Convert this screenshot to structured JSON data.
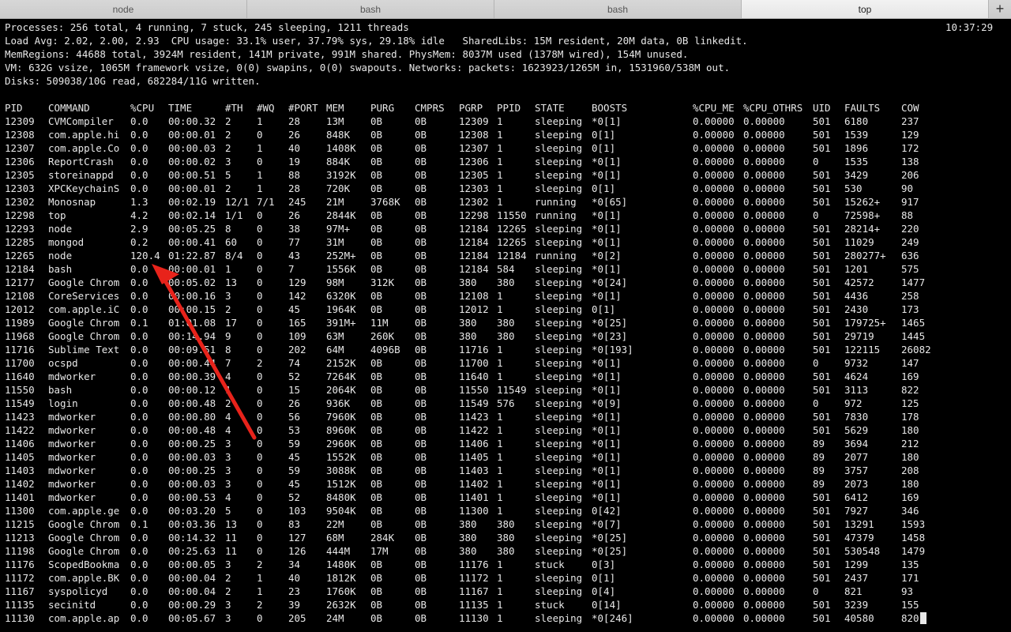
{
  "tabs": [
    {
      "label": "node",
      "active": false
    },
    {
      "label": "bash",
      "active": false
    },
    {
      "label": "bash",
      "active": false
    },
    {
      "label": "top",
      "active": true
    }
  ],
  "new_tab_label": "+",
  "clock": "10:37:29",
  "header_lines": [
    "Processes: 256 total, 4 running, 7 stuck, 245 sleeping, 1211 threads",
    "Load Avg: 2.02, 2.00, 2.93  CPU usage: 33.1% user, 37.79% sys, 29.18% idle   SharedLibs: 15M resident, 20M data, 0B linkedit.",
    "MemRegions: 44688 total, 3924M resident, 141M private, 991M shared. PhysMem: 8037M used (1378M wired), 154M unused.",
    "VM: 632G vsize, 1065M framework vsize, 0(0) swapins, 0(0) swapouts. Networks: packets: 1623923/1265M in, 1531960/538M out.",
    "Disks: 509038/10G read, 682284/11G written."
  ],
  "columns": [
    "PID",
    "COMMAND",
    "%CPU",
    "TIME",
    "#TH",
    "#WQ",
    "#PORT",
    "MEM",
    "PURG",
    "CMPRS",
    "PGRP",
    "PPID",
    "STATE",
    "BOOSTS",
    "%CPU_ME",
    "%CPU_OTHRS",
    "UID",
    "FAULTS",
    "COW"
  ],
  "rows": [
    [
      "12309",
      "CVMCompiler",
      "0.0",
      "00:00.32",
      "2",
      "1",
      "28",
      "13M",
      "0B",
      "0B",
      "12309",
      "1",
      "sleeping",
      "*0[1]",
      "0.00000",
      "0.00000",
      "501",
      "6180",
      "237"
    ],
    [
      "12308",
      "com.apple.hi",
      "0.0",
      "00:00.01",
      "2",
      "0",
      "26",
      "848K",
      "0B",
      "0B",
      "12308",
      "1",
      "sleeping",
      "0[1]",
      "0.00000",
      "0.00000",
      "501",
      "1539",
      "129"
    ],
    [
      "12307",
      "com.apple.Co",
      "0.0",
      "00:00.03",
      "2",
      "1",
      "40",
      "1408K",
      "0B",
      "0B",
      "12307",
      "1",
      "sleeping",
      "0[1]",
      "0.00000",
      "0.00000",
      "501",
      "1896",
      "172"
    ],
    [
      "12306",
      "ReportCrash",
      "0.0",
      "00:00.02",
      "3",
      "0",
      "19",
      "884K",
      "0B",
      "0B",
      "12306",
      "1",
      "sleeping",
      "*0[1]",
      "0.00000",
      "0.00000",
      "0",
      "1535",
      "138"
    ],
    [
      "12305",
      "storeinappd",
      "0.0",
      "00:00.51",
      "5",
      "1",
      "88",
      "3192K",
      "0B",
      "0B",
      "12305",
      "1",
      "sleeping",
      "*0[1]",
      "0.00000",
      "0.00000",
      "501",
      "3429",
      "206"
    ],
    [
      "12303",
      "XPCKeychainS",
      "0.0",
      "00:00.01",
      "2",
      "1",
      "28",
      "720K",
      "0B",
      "0B",
      "12303",
      "1",
      "sleeping",
      "0[1]",
      "0.00000",
      "0.00000",
      "501",
      "530",
      "90"
    ],
    [
      "12302",
      "Monosnap",
      "1.3",
      "00:02.19",
      "12/1",
      "7/1",
      "245",
      "21M",
      "3768K",
      "0B",
      "12302",
      "1",
      "running",
      "*0[65]",
      "0.00000",
      "0.00000",
      "501",
      "15262+",
      "917"
    ],
    [
      "12298",
      "top",
      "4.2",
      "00:02.14",
      "1/1",
      "0",
      "26",
      "2844K",
      "0B",
      "0B",
      "12298",
      "11550",
      "running",
      "*0[1]",
      "0.00000",
      "0.00000",
      "0",
      "72598+",
      "88"
    ],
    [
      "12293",
      "node",
      "2.9",
      "00:05.25",
      "8",
      "0",
      "38",
      "97M+",
      "0B",
      "0B",
      "12184",
      "12265",
      "sleeping",
      "*0[1]",
      "0.00000",
      "0.00000",
      "501",
      "28214+",
      "220"
    ],
    [
      "12285",
      "mongod",
      "0.2",
      "00:00.41",
      "60",
      "0",
      "77",
      "31M",
      "0B",
      "0B",
      "12184",
      "12265",
      "sleeping",
      "*0[1]",
      "0.00000",
      "0.00000",
      "501",
      "11029",
      "249"
    ],
    [
      "12265",
      "node",
      "120.4",
      "01:22.87",
      "8/4",
      "0",
      "43",
      "252M+",
      "0B",
      "0B",
      "12184",
      "12184",
      "running",
      "*0[2]",
      "0.00000",
      "0.00000",
      "501",
      "280277+",
      "636"
    ],
    [
      "12184",
      "bash",
      "0.0",
      "00:00.01",
      "1",
      "0",
      "7",
      "1556K",
      "0B",
      "0B",
      "12184",
      "584",
      "sleeping",
      "*0[1]",
      "0.00000",
      "0.00000",
      "501",
      "1201",
      "575"
    ],
    [
      "12177",
      "Google Chrom",
      "0.0",
      "00:05.02",
      "13",
      "0",
      "129",
      "98M",
      "312K",
      "0B",
      "380",
      "380",
      "sleeping",
      "*0[24]",
      "0.00000",
      "0.00000",
      "501",
      "42572",
      "1477"
    ],
    [
      "12108",
      "CoreServices",
      "0.0",
      "00:00.16",
      "3",
      "0",
      "142",
      "6320K",
      "0B",
      "0B",
      "12108",
      "1",
      "sleeping",
      "*0[1]",
      "0.00000",
      "0.00000",
      "501",
      "4436",
      "258"
    ],
    [
      "12012",
      "com.apple.iC",
      "0.0",
      "00:00.15",
      "2",
      "0",
      "45",
      "1964K",
      "0B",
      "0B",
      "12012",
      "1",
      "sleeping",
      "0[1]",
      "0.00000",
      "0.00000",
      "501",
      "2430",
      "173"
    ],
    [
      "11989",
      "Google Chrom",
      "0.1",
      "01:01.08",
      "17",
      "0",
      "165",
      "391M+",
      "11M",
      "0B",
      "380",
      "380",
      "sleeping",
      "*0[25]",
      "0.00000",
      "0.00000",
      "501",
      "179725+",
      "1465"
    ],
    [
      "11968",
      "Google Chrom",
      "0.0",
      "00:14.94",
      "9",
      "0",
      "109",
      "63M",
      "260K",
      "0B",
      "380",
      "380",
      "sleeping",
      "*0[23]",
      "0.00000",
      "0.00000",
      "501",
      "29719",
      "1445"
    ],
    [
      "11716",
      "Sublime Text",
      "0.0",
      "00:09.51",
      "8",
      "0",
      "202",
      "64M",
      "4096B",
      "0B",
      "11716",
      "1",
      "sleeping",
      "*0[193]",
      "0.00000",
      "0.00000",
      "501",
      "122115",
      "26082"
    ],
    [
      "11700",
      "ocspd",
      "0.0",
      "00:00.44",
      "7",
      "2",
      "74",
      "2152K",
      "0B",
      "0B",
      "11700",
      "1",
      "sleeping",
      "*0[1]",
      "0.00000",
      "0.00000",
      "0",
      "9732",
      "147"
    ],
    [
      "11640",
      "mdworker",
      "0.0",
      "00:00.39",
      "4",
      "0",
      "52",
      "7264K",
      "0B",
      "0B",
      "11640",
      "1",
      "sleeping",
      "*0[1]",
      "0.00000",
      "0.00000",
      "501",
      "4624",
      "169"
    ],
    [
      "11550",
      "bash",
      "0.0",
      "00:00.12",
      "1",
      "0",
      "15",
      "2064K",
      "0B",
      "0B",
      "11550",
      "11549",
      "sleeping",
      "*0[1]",
      "0.00000",
      "0.00000",
      "501",
      "3113",
      "822"
    ],
    [
      "11549",
      "login",
      "0.0",
      "00:00.48",
      "2",
      "0",
      "26",
      "936K",
      "0B",
      "0B",
      "11549",
      "576",
      "sleeping",
      "*0[9]",
      "0.00000",
      "0.00000",
      "0",
      "972",
      "125"
    ],
    [
      "11423",
      "mdworker",
      "0.0",
      "00:00.80",
      "4",
      "0",
      "56",
      "7960K",
      "0B",
      "0B",
      "11423",
      "1",
      "sleeping",
      "*0[1]",
      "0.00000",
      "0.00000",
      "501",
      "7830",
      "178"
    ],
    [
      "11422",
      "mdworker",
      "0.0",
      "00:00.48",
      "4",
      "0",
      "53",
      "8960K",
      "0B",
      "0B",
      "11422",
      "1",
      "sleeping",
      "*0[1]",
      "0.00000",
      "0.00000",
      "501",
      "5629",
      "180"
    ],
    [
      "11406",
      "mdworker",
      "0.0",
      "00:00.25",
      "3",
      "0",
      "59",
      "2960K",
      "0B",
      "0B",
      "11406",
      "1",
      "sleeping",
      "*0[1]",
      "0.00000",
      "0.00000",
      "89",
      "3694",
      "212"
    ],
    [
      "11405",
      "mdworker",
      "0.0",
      "00:00.03",
      "3",
      "0",
      "45",
      "1552K",
      "0B",
      "0B",
      "11405",
      "1",
      "sleeping",
      "*0[1]",
      "0.00000",
      "0.00000",
      "89",
      "2077",
      "180"
    ],
    [
      "11403",
      "mdworker",
      "0.0",
      "00:00.25",
      "3",
      "0",
      "59",
      "3088K",
      "0B",
      "0B",
      "11403",
      "1",
      "sleeping",
      "*0[1]",
      "0.00000",
      "0.00000",
      "89",
      "3757",
      "208"
    ],
    [
      "11402",
      "mdworker",
      "0.0",
      "00:00.03",
      "3",
      "0",
      "45",
      "1512K",
      "0B",
      "0B",
      "11402",
      "1",
      "sleeping",
      "*0[1]",
      "0.00000",
      "0.00000",
      "89",
      "2073",
      "180"
    ],
    [
      "11401",
      "mdworker",
      "0.0",
      "00:00.53",
      "4",
      "0",
      "52",
      "8480K",
      "0B",
      "0B",
      "11401",
      "1",
      "sleeping",
      "*0[1]",
      "0.00000",
      "0.00000",
      "501",
      "6412",
      "169"
    ],
    [
      "11300",
      "com.apple.ge",
      "0.0",
      "00:03.20",
      "5",
      "0",
      "103",
      "9504K",
      "0B",
      "0B",
      "11300",
      "1",
      "sleeping",
      "0[42]",
      "0.00000",
      "0.00000",
      "501",
      "7927",
      "346"
    ],
    [
      "11215",
      "Google Chrom",
      "0.1",
      "00:03.36",
      "13",
      "0",
      "83",
      "22M",
      "0B",
      "0B",
      "380",
      "380",
      "sleeping",
      "*0[7]",
      "0.00000",
      "0.00000",
      "501",
      "13291",
      "1593"
    ],
    [
      "11213",
      "Google Chrom",
      "0.0",
      "00:14.32",
      "11",
      "0",
      "127",
      "68M",
      "284K",
      "0B",
      "380",
      "380",
      "sleeping",
      "*0[25]",
      "0.00000",
      "0.00000",
      "501",
      "47379",
      "1458"
    ],
    [
      "11198",
      "Google Chrom",
      "0.0",
      "00:25.63",
      "11",
      "0",
      "126",
      "444M",
      "17M",
      "0B",
      "380",
      "380",
      "sleeping",
      "*0[25]",
      "0.00000",
      "0.00000",
      "501",
      "530548",
      "1479"
    ],
    [
      "11176",
      "ScopedBookma",
      "0.0",
      "00:00.05",
      "3",
      "2",
      "34",
      "1480K",
      "0B",
      "0B",
      "11176",
      "1",
      "stuck",
      "0[3]",
      "0.00000",
      "0.00000",
      "501",
      "1299",
      "135"
    ],
    [
      "11172",
      "com.apple.BK",
      "0.0",
      "00:00.04",
      "2",
      "1",
      "40",
      "1812K",
      "0B",
      "0B",
      "11172",
      "1",
      "sleeping",
      "0[1]",
      "0.00000",
      "0.00000",
      "501",
      "2437",
      "171"
    ],
    [
      "11167",
      "syspolicyd",
      "0.0",
      "00:00.04",
      "2",
      "1",
      "23",
      "1760K",
      "0B",
      "0B",
      "11167",
      "1",
      "sleeping",
      "0[4]",
      "0.00000",
      "0.00000",
      "0",
      "821",
      "93"
    ],
    [
      "11135",
      "secinitd",
      "0.0",
      "00:00.29",
      "3",
      "2",
      "39",
      "2632K",
      "0B",
      "0B",
      "11135",
      "1",
      "stuck",
      "0[14]",
      "0.00000",
      "0.00000",
      "501",
      "3239",
      "155"
    ],
    [
      "11130",
      "com.apple.ap",
      "0.0",
      "00:05.67",
      "3",
      "0",
      "205",
      "24M",
      "0B",
      "0B",
      "11130",
      "1",
      "sleeping",
      "*0[246]",
      "0.00000",
      "0.00000",
      "501",
      "40580",
      "820"
    ]
  ],
  "colors": {
    "background": "#000000",
    "text": "#e8e8e8",
    "annotation_arrow": "#e8231b",
    "tabbar": "#d5d5d5"
  }
}
